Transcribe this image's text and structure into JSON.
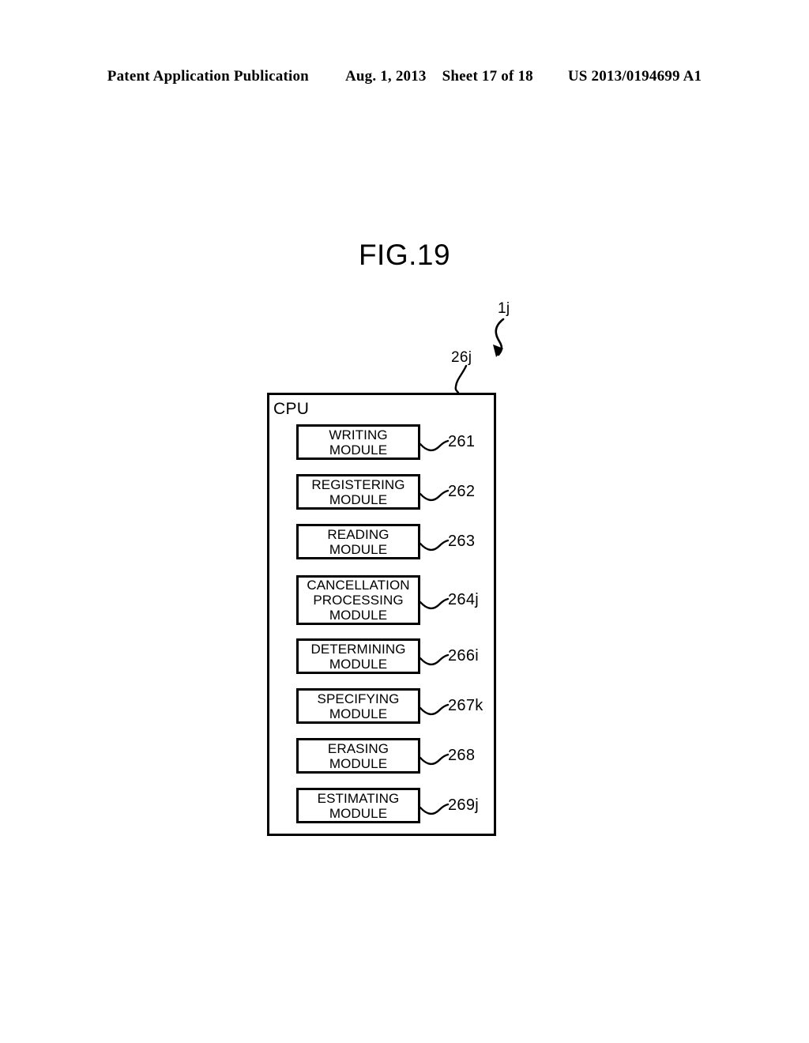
{
  "header": {
    "publication": "Patent Application Publication",
    "date": "Aug. 1, 2013",
    "sheet": "Sheet 17 of 18",
    "patent_number": "US 2013/0194699 A1"
  },
  "figure": {
    "title": "FIG.19",
    "system_label": "1j",
    "cpu_label": "CPU",
    "cpu_ref": "26j"
  },
  "modules": [
    {
      "lines": [
        "WRITING",
        "MODULE"
      ],
      "ref": "261"
    },
    {
      "lines": [
        "REGISTERING",
        "MODULE"
      ],
      "ref": "262"
    },
    {
      "lines": [
        "READING",
        "MODULE"
      ],
      "ref": "263"
    },
    {
      "lines": [
        "CANCELLATION",
        "PROCESSING",
        "MODULE"
      ],
      "ref": "264j"
    },
    {
      "lines": [
        "DETERMINING",
        "MODULE"
      ],
      "ref": "266i"
    },
    {
      "lines": [
        "SPECIFYING",
        "MODULE"
      ],
      "ref": "267k"
    },
    {
      "lines": [
        "ERASING",
        "MODULE"
      ],
      "ref": "268"
    },
    {
      "lines": [
        "ESTIMATING",
        "MODULE"
      ],
      "ref": "269j"
    }
  ],
  "colors": {
    "ink": "#000000",
    "paper": "#ffffff"
  }
}
